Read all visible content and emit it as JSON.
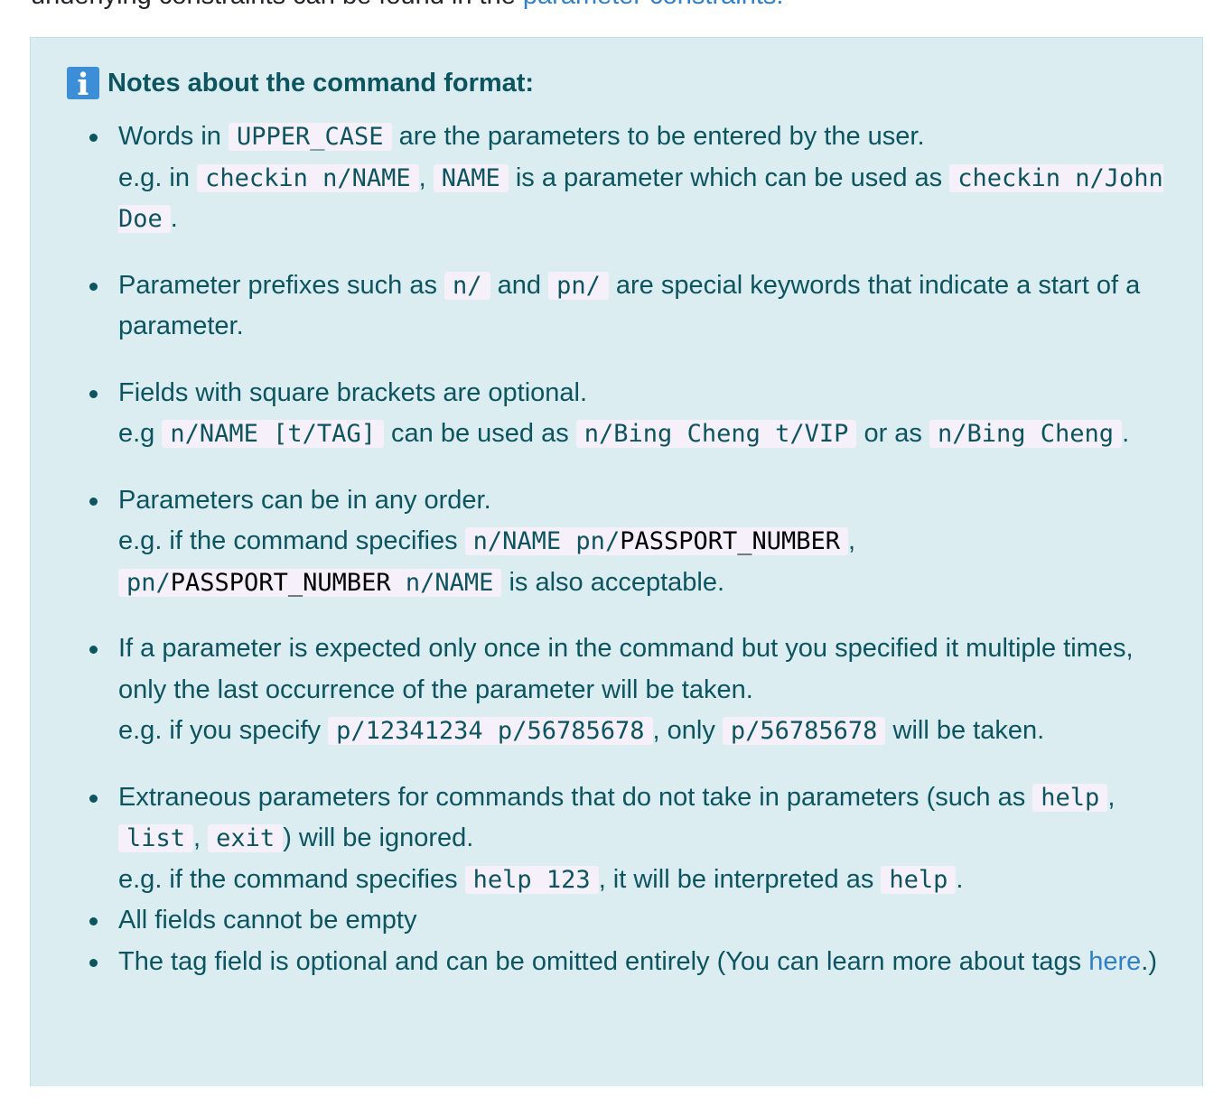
{
  "top_text": {
    "prefix": "underlying constraints can be found in the ",
    "link": "parameter constraints."
  },
  "callout": {
    "title": "Notes about the command format:",
    "icon": "info-icon",
    "items": [
      {
        "l1": "Words in ",
        "c1": "UPPER_CASE",
        "l2": " are the parameters to be entered by the user.",
        "l3": "e.g. in ",
        "c2": "checkin n/NAME",
        "l4": ", ",
        "c3": "NAME",
        "l5": " is a parameter which can be used as ",
        "c4": "checkin n/John Doe",
        "l6": "."
      },
      {
        "l1": "Parameter prefixes such as ",
        "c1": "n/",
        "l2": " and ",
        "c2": "pn/",
        "l3": " are special keywords that indicate a start of a parameter."
      },
      {
        "l1": "Fields with square brackets are optional.",
        "l2": "e.g ",
        "c1": "n/NAME [t/TAG]",
        "l3": " can be used as ",
        "c2": "n/Bing Cheng t/VIP",
        "l4": " or as ",
        "c3": "n/Bing Cheng",
        "l5": "."
      },
      {
        "l1": "Parameters can be in any order.",
        "l2": "e.g. if the command specifies ",
        "c1a": "n/NAME pn/",
        "c1b": "PASSPORT_NUMBER",
        "l3": ",",
        "c2a": "pn/",
        "c2b": "PASSPORT_NUMBER",
        "c2c": " n/NAME",
        "l4": " is also acceptable."
      },
      {
        "l1": "If a parameter is expected only once in the command but you specified it multiple times, only the last occurrence of the parameter will be taken.",
        "l2": "e.g. if you specify ",
        "c1": "p/12341234 p/56785678",
        "l3": ", only ",
        "c2": "p/56785678",
        "l4": " will be taken."
      },
      {
        "l1": "Extraneous parameters for commands that do not take in parameters (such as ",
        "c1": "help",
        "l2": ", ",
        "c2": "list",
        "l3": ", ",
        "c3": "exit",
        "l4": ") will be ignored.",
        "l5": "e.g. if the command specifies ",
        "c4": "help 123",
        "l6": ", it will be interpreted as ",
        "c5": "help",
        "l7": "."
      },
      {
        "l1": "All fields cannot be empty"
      },
      {
        "l1": "The tag field is optional and can be omitted entirely (You can learn more about tags ",
        "link": "here",
        "l2": ".)"
      }
    ]
  }
}
